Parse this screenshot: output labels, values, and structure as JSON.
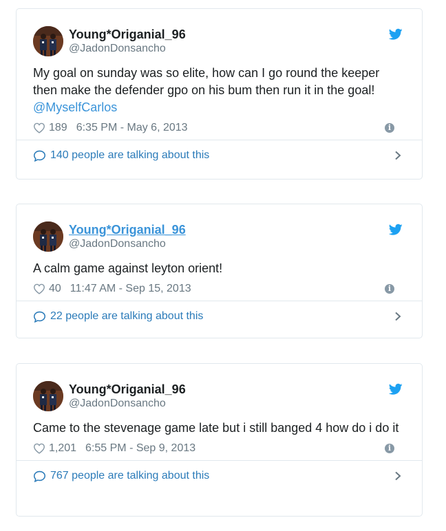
{
  "tweets": [
    {
      "display_name": "Young*Origanial_96",
      "screen_name": "@JadonDonsancho",
      "text": "My goal on sunday was so elite, how can I go round the keeper then make the defender gpo on his bum then run it in the goal!",
      "mention": "@MyselfCarlos",
      "likes": "189",
      "timestamp": "6:35 PM - May 6, 2013",
      "talking": "140 people are talking about this"
    },
    {
      "display_name": "Young*Origanial_96",
      "screen_name": "@JadonDonsancho",
      "text": "A calm game against leyton orient!",
      "likes": "40",
      "timestamp": "11:47 AM - Sep 15, 2013",
      "talking": "22 people are talking about this"
    },
    {
      "display_name": "Young*Origanial_96",
      "screen_name": "@JadonDonsancho",
      "text": "Came to the stevenage game late but i still banged 4 how do i do it",
      "likes": "1,201",
      "timestamp": "6:55 PM - Sep 9, 2013",
      "talking": "767 people are talking about this"
    }
  ],
  "icons": {
    "brand": "twitter-bird-icon",
    "like": "heart-icon",
    "info": "info-icon",
    "reply": "speech-bubble-icon",
    "more": "chevron-right-icon"
  },
  "colors": {
    "twitter_blue": "#1da1f2",
    "link_blue": "#2b7bb9",
    "gray_text": "#697882",
    "border": "#e1e8ed"
  }
}
